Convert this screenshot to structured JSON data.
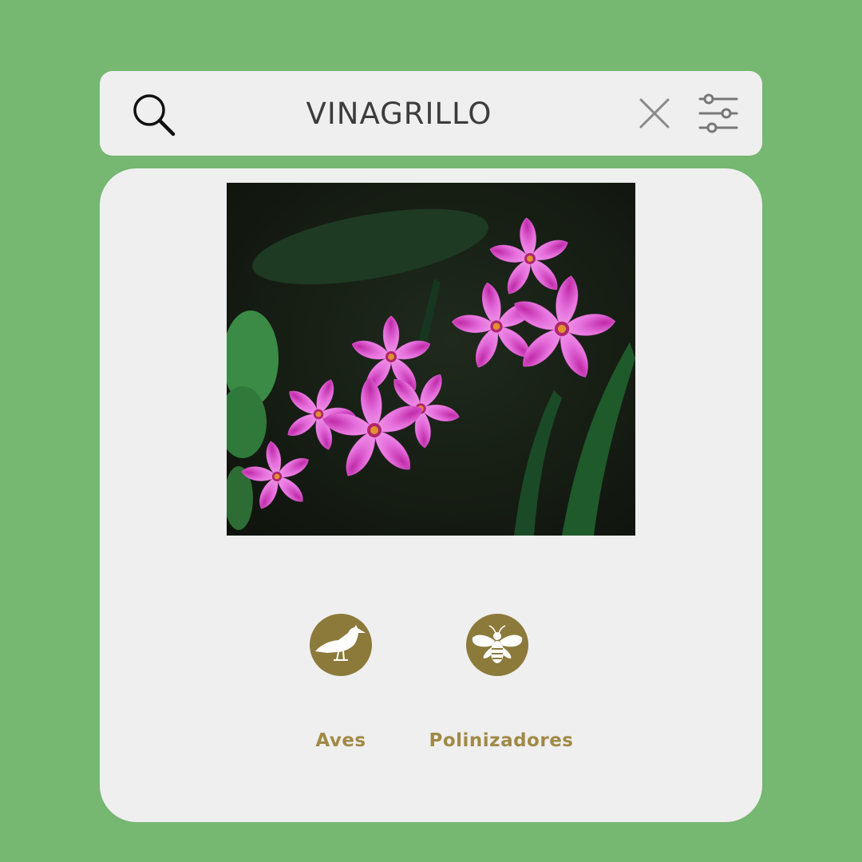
{
  "search": {
    "query": "VINAGRILLO",
    "icons": {
      "search": "search-icon",
      "clear": "close-icon",
      "filter": "sliders-icon"
    }
  },
  "result": {
    "image": {
      "subject": "pink five-petaled flowers"
    },
    "categories": [
      {
        "label": "Aves",
        "icon": "bird-icon"
      },
      {
        "label": "Polinizadores",
        "icon": "bee-icon"
      }
    ]
  },
  "colors": {
    "background": "#76b772",
    "panel": "#efefef",
    "badge": "#8c7a3b",
    "badge_label": "#a08a45",
    "query_text": "#3c3c3c"
  }
}
